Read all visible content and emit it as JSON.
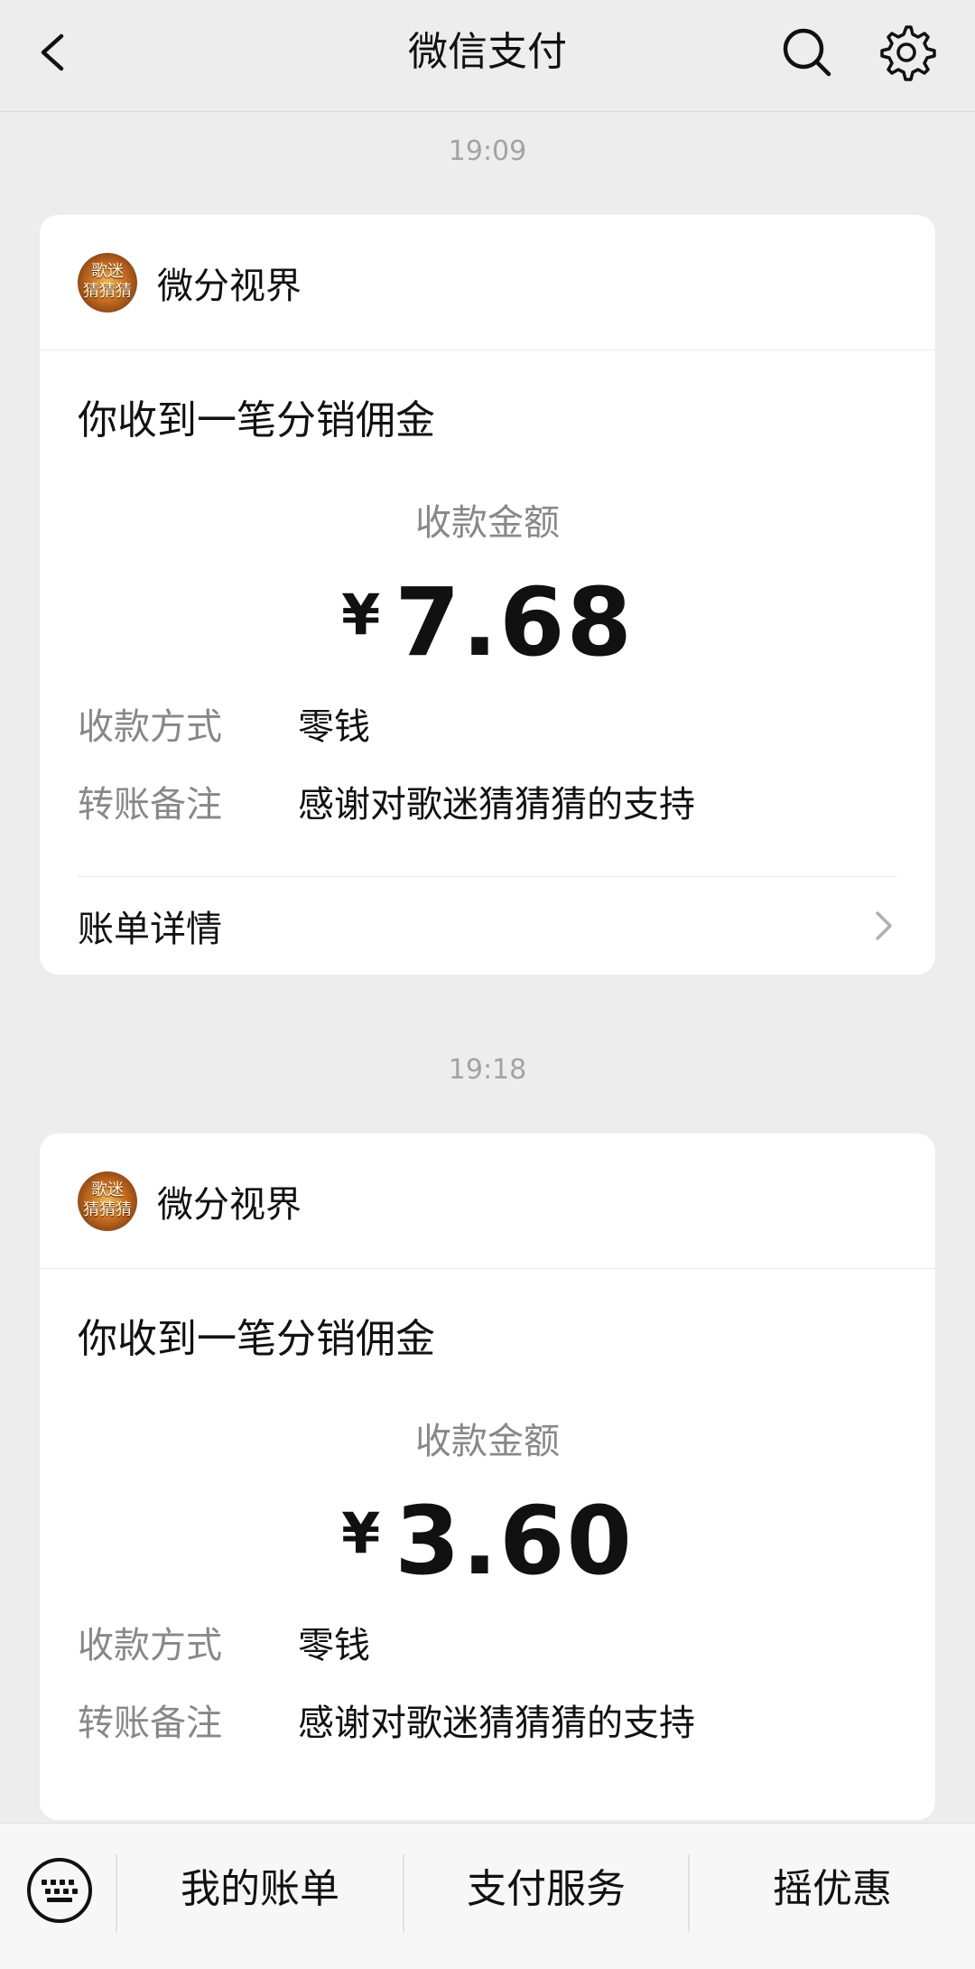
{
  "header": {
    "title": "微信支付",
    "back_icon": "chevron-left-icon",
    "search_icon": "search-icon",
    "settings_icon": "gear-icon"
  },
  "messages": [
    {
      "time": "19:09",
      "merchant": "微分视界",
      "avatar_text": "歌迷\n猜猜猜",
      "title": "你收到一笔分销佣金",
      "amount_label": "收款金额",
      "currency": "¥",
      "amount": "7.68",
      "rows": [
        {
          "key": "收款方式",
          "value": "零钱"
        },
        {
          "key": "转账备注",
          "value": "感谢对歌迷猜猜猜的支持"
        }
      ],
      "detail_label": "账单详情"
    },
    {
      "time": "19:18",
      "merchant": "微分视界",
      "avatar_text": "歌迷\n猜猜猜",
      "title": "你收到一笔分销佣金",
      "amount_label": "收款金额",
      "currency": "¥",
      "amount": "3.60",
      "rows": [
        {
          "key": "收款方式",
          "value": "零钱"
        },
        {
          "key": "转账备注",
          "value": "感谢对歌迷猜猜猜的支持"
        }
      ]
    }
  ],
  "bottom_bar": {
    "keyboard_icon": "keyboard-icon",
    "items": [
      "我的账单",
      "支付服务",
      "摇优惠"
    ]
  }
}
